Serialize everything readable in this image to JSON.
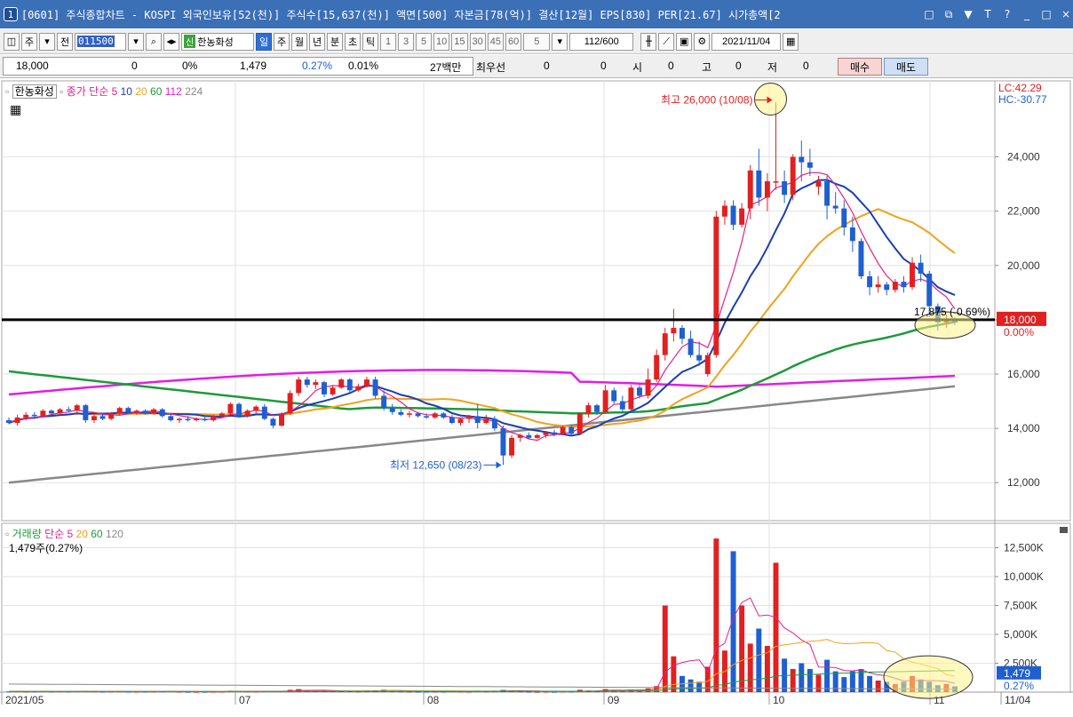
{
  "window": {
    "icon_number": "1",
    "title": "[0601] 주식종합차트 - KOSPI 외국인보유[52(천)] 주식수[15,637(천)] 액면[500] 자본금[78(억)] 결산[12월] EPS[830] PER[21.67] 시가총액[2",
    "buttons": [
      "□",
      "⧉",
      "▼",
      "T",
      "?",
      "_",
      "□",
      "×"
    ]
  },
  "toolbar": {
    "market_tabs": [
      "주",
      "전"
    ],
    "stock_code": "011500",
    "stock_name_prefix": "신",
    "stock_name": "한농화성",
    "periods": [
      "일",
      "주",
      "월",
      "년",
      "분",
      "초",
      "틱"
    ],
    "active_period": "일",
    "intervals": [
      "1",
      "3",
      "5",
      "10",
      "15",
      "30",
      "45",
      "60"
    ],
    "custom_interval": "5",
    "count": "112",
    "count_total": "/600",
    "date": "2021/11/04"
  },
  "quote": {
    "price": "18,000",
    "change": "0",
    "change_pct": "0%",
    "volume": "1,479",
    "volume_pct": "0.27%",
    "turnover": "0.01%",
    "amount": "27백만",
    "best_ask_label": "최우선",
    "best_ask": "0",
    "best_bid": "0",
    "open_label": "시",
    "open": "0",
    "high_label": "고",
    "high": "0",
    "low_label": "저",
    "low": "0",
    "buy_button": "매수",
    "sell_button": "매도"
  },
  "legend": {
    "stock": "한농화성",
    "ma_label": "종가 단순",
    "ma_periods": [
      "5",
      "10",
      "20",
      "60",
      "112",
      "224"
    ],
    "ma_colors": [
      "#e61f8c",
      "#1b3fb0",
      "#f0a21c",
      "#1e9a3a",
      "#e41ce8",
      "#888888"
    ],
    "volume_label": "거래량",
    "volume_ma_label": "단순",
    "volume_ma_periods": [
      "5",
      "20",
      "60",
      "120"
    ],
    "volume_ma_colors": [
      "#e61f8c",
      "#f0a21c",
      "#1e9a3a",
      "#888888"
    ],
    "volume_current": "1,479주(0.27%)"
  },
  "annotations": {
    "high": "최고 26,000 (10/08)",
    "low": "최저 12,650 (08/23)",
    "current": "17,875 (-0.69%)",
    "lc": "LC:42.29",
    "hc": "HC:-30.77",
    "price_tag": "18,000",
    "price_tag_pct": "0.00%",
    "volume_tag": "1,479",
    "volume_tag_pct": "0.27%"
  },
  "chart_data": {
    "type": "candlestick",
    "price_axis": [
      "24,000",
      "22,000",
      "20,000",
      "18,000",
      "16,000",
      "14,000",
      "12,000"
    ],
    "price_ylim": [
      10600,
      26800
    ],
    "volume_axis": [
      "12,500K",
      "10,000K",
      "7,500K",
      "5,000K",
      "2,500K"
    ],
    "volume_ylim": [
      0,
      14000
    ],
    "x_labels": [
      "2021/05",
      "07",
      "08",
      "09",
      "10",
      "11",
      "11/04"
    ],
    "horizontal_line": 18000,
    "colors": {
      "up": "#e22020",
      "down": "#1f5fd0"
    },
    "candles": [
      [
        14300,
        14400,
        14150,
        14200,
        60
      ],
      [
        14200,
        14500,
        14100,
        14400,
        70
      ],
      [
        14400,
        14600,
        14300,
        14500,
        50
      ],
      [
        14500,
        14600,
        14350,
        14450,
        60
      ],
      [
        14450,
        14700,
        14400,
        14650,
        80
      ],
      [
        14650,
        14700,
        14500,
        14550,
        50
      ],
      [
        14550,
        14750,
        14500,
        14700,
        60
      ],
      [
        14700,
        14800,
        14600,
        14650,
        50
      ],
      [
        14650,
        14900,
        14500,
        14850,
        70
      ],
      [
        14850,
        14900,
        14200,
        14300,
        90
      ],
      [
        14300,
        14500,
        14200,
        14450,
        60
      ],
      [
        14450,
        14550,
        14300,
        14350,
        40
      ],
      [
        14350,
        14600,
        14300,
        14550,
        50
      ],
      [
        14550,
        14800,
        14500,
        14750,
        60
      ],
      [
        14750,
        14800,
        14550,
        14600,
        40
      ],
      [
        14600,
        14700,
        14500,
        14650,
        40
      ],
      [
        14650,
        14700,
        14500,
        14550,
        40
      ],
      [
        14550,
        14750,
        14500,
        14700,
        50
      ],
      [
        14700,
        14750,
        14400,
        14450,
        60
      ],
      [
        14450,
        14500,
        14250,
        14300,
        80
      ],
      [
        14300,
        14400,
        14200,
        14350,
        40
      ],
      [
        14350,
        14450,
        14250,
        14300,
        30
      ],
      [
        14300,
        14400,
        14250,
        14350,
        30
      ],
      [
        14350,
        14450,
        14250,
        14300,
        30
      ],
      [
        14300,
        14500,
        14250,
        14450,
        40
      ],
      [
        14450,
        14600,
        14400,
        14550,
        40
      ],
      [
        14550,
        14950,
        14500,
        14900,
        120
      ],
      [
        14900,
        14950,
        14400,
        14450,
        90
      ],
      [
        14450,
        14700,
        14400,
        14650,
        60
      ],
      [
        14650,
        14850,
        14550,
        14800,
        50
      ],
      [
        14800,
        14900,
        14300,
        14350,
        80
      ],
      [
        14350,
        14400,
        14000,
        14100,
        100
      ],
      [
        14100,
        14600,
        14050,
        14550,
        80
      ],
      [
        14550,
        15400,
        14500,
        15300,
        200
      ],
      [
        15300,
        15900,
        15200,
        15800,
        260
      ],
      [
        15800,
        15900,
        15500,
        15600,
        140
      ],
      [
        15600,
        15800,
        15450,
        15700,
        90
      ],
      [
        15700,
        15750,
        15150,
        15250,
        120
      ],
      [
        15250,
        15600,
        15200,
        15500,
        80
      ],
      [
        15500,
        15850,
        15450,
        15800,
        100
      ],
      [
        15800,
        15850,
        15300,
        15400,
        90
      ],
      [
        15400,
        15650,
        15350,
        15550,
        60
      ],
      [
        15550,
        15900,
        15500,
        15800,
        120
      ],
      [
        15800,
        15900,
        15100,
        15200,
        150
      ],
      [
        15200,
        15400,
        14650,
        14750,
        200
      ],
      [
        14750,
        14900,
        14500,
        14600,
        120
      ],
      [
        14600,
        14700,
        14450,
        14500,
        60
      ],
      [
        14500,
        14650,
        14400,
        14550,
        50
      ],
      [
        14550,
        14600,
        14400,
        14450,
        40
      ],
      [
        14450,
        14550,
        14350,
        14400,
        40
      ],
      [
        14400,
        14600,
        14350,
        14550,
        50
      ],
      [
        14550,
        14600,
        14350,
        14400,
        40
      ],
      [
        14400,
        14500,
        14150,
        14200,
        70
      ],
      [
        14200,
        14400,
        14100,
        14350,
        50
      ],
      [
        14350,
        14500,
        14200,
        14450,
        40
      ],
      [
        14450,
        14900,
        14000,
        14200,
        90
      ],
      [
        14200,
        14500,
        14150,
        14350,
        60
      ],
      [
        14350,
        14450,
        13900,
        14000,
        110
      ],
      [
        14000,
        14100,
        12650,
        13000,
        190
      ],
      [
        13000,
        13750,
        12900,
        13650,
        150
      ],
      [
        13650,
        13800,
        13500,
        13750,
        60
      ],
      [
        13750,
        13850,
        13600,
        13650,
        40
      ],
      [
        13650,
        13800,
        13600,
        13750,
        30
      ],
      [
        13750,
        13900,
        13650,
        13850,
        40
      ],
      [
        13850,
        13950,
        13700,
        13800,
        30
      ],
      [
        13800,
        14100,
        13750,
        14050,
        50
      ],
      [
        14050,
        14150,
        13750,
        13800,
        40
      ],
      [
        13800,
        14600,
        13750,
        14550,
        200
      ],
      [
        14550,
        14950,
        14400,
        14850,
        130
      ],
      [
        14850,
        14900,
        14500,
        14600,
        90
      ],
      [
        14600,
        15600,
        14550,
        15400,
        260
      ],
      [
        15400,
        15500,
        14900,
        15000,
        180
      ],
      [
        15000,
        15200,
        14600,
        14700,
        150
      ],
      [
        14700,
        15600,
        14650,
        15500,
        220
      ],
      [
        15500,
        15600,
        15100,
        15200,
        130
      ],
      [
        15200,
        16200,
        15100,
        15800,
        320
      ],
      [
        15800,
        16900,
        15700,
        16700,
        520
      ],
      [
        16700,
        17700,
        16500,
        17500,
        7500
      ],
      [
        17500,
        18400,
        17200,
        17700,
        3100
      ],
      [
        17700,
        17800,
        17100,
        17300,
        1400
      ],
      [
        17300,
        17600,
        16600,
        16700,
        1100
      ],
      [
        16700,
        17200,
        16300,
        16500,
        900
      ],
      [
        16000,
        16800,
        15900,
        16700,
        2200
      ],
      [
        16700,
        22000,
        16600,
        21800,
        13300
      ],
      [
        21800,
        22400,
        21500,
        22200,
        3600
      ],
      [
        22200,
        22400,
        21300,
        21500,
        12200
      ],
      [
        21500,
        22300,
        21400,
        22100,
        7500
      ],
      [
        22100,
        23700,
        21700,
        23500,
        4200
      ],
      [
        23500,
        24300,
        22200,
        22500,
        5500
      ],
      [
        22500,
        23400,
        22000,
        23100,
        4000
      ],
      [
        23100,
        26000,
        22800,
        23100,
        11200
      ],
      [
        23100,
        23500,
        22300,
        22600,
        2900
      ],
      [
        22600,
        24100,
        22400,
        24000,
        2000
      ],
      [
        24000,
        24600,
        23100,
        23800,
        2500
      ],
      [
        23800,
        24300,
        23300,
        23600,
        2000
      ],
      [
        22900,
        23300,
        22600,
        23100,
        1500
      ],
      [
        23100,
        23300,
        21700,
        22200,
        2800
      ],
      [
        22200,
        22700,
        21900,
        22100,
        1800
      ],
      [
        22100,
        22400,
        21100,
        21400,
        1300
      ],
      [
        21400,
        21800,
        20500,
        20900,
        1800
      ],
      [
        20900,
        21000,
        19500,
        19600,
        2000
      ],
      [
        19600,
        19800,
        18900,
        19200,
        1400
      ],
      [
        19200,
        19600,
        19000,
        19300,
        1000
      ],
      [
        19300,
        19400,
        18900,
        19100,
        900
      ],
      [
        19100,
        19500,
        19000,
        19400,
        700
      ],
      [
        19400,
        19600,
        19000,
        19200,
        900
      ],
      [
        19200,
        20300,
        19100,
        20100,
        1400
      ],
      [
        20100,
        20400,
        19400,
        19700,
        1100
      ],
      [
        19700,
        19800,
        18100,
        18500,
        900
      ],
      [
        18500,
        18600,
        17600,
        17900,
        600
      ],
      [
        17900,
        18200,
        17700,
        18000,
        700
      ],
      [
        18000,
        18100,
        17800,
        17900,
        500
      ]
    ]
  }
}
